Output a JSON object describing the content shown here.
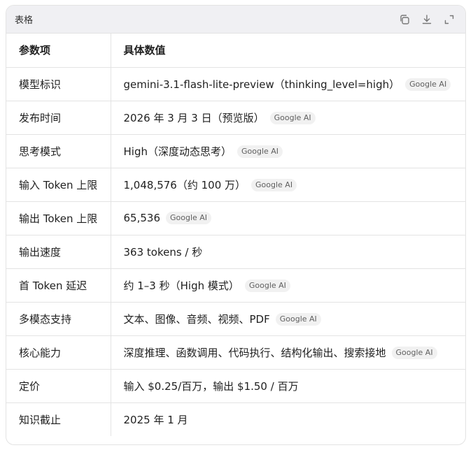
{
  "header": {
    "title": "表格"
  },
  "table": {
    "headers": [
      "参数项",
      "具体数值"
    ],
    "rows": [
      {
        "key": "模型标识",
        "value": "gemini-3.1-flash-lite-preview（thinking_level=high）",
        "source": "Google AI"
      },
      {
        "key": "发布时间",
        "value": "2026 年 3 月 3 日（预览版）",
        "source": "Google AI"
      },
      {
        "key": "思考模式",
        "value": "High（深度动态思考）",
        "source": "Google AI"
      },
      {
        "key": "输入 Token 上限",
        "value": "1,048,576（约 100 万）",
        "source": "Google AI"
      },
      {
        "key": "输出 Token 上限",
        "value": "65,536",
        "source": "Google AI"
      },
      {
        "key": "输出速度",
        "value": "363 tokens / 秒",
        "source": ""
      },
      {
        "key": "首 Token 延迟",
        "value": "约 1–3 秒（High 模式）",
        "source": "Google AI"
      },
      {
        "key": "多模态支持",
        "value": "文本、图像、音频、视频、PDF",
        "source": "Google AI"
      },
      {
        "key": "核心能力",
        "value": "深度推理、函数调用、代码执行、结构化输出、搜索接地",
        "source": "Google AI"
      },
      {
        "key": "定价",
        "value": "输入 $0.25/百万，输出 $1.50 / 百万",
        "source": ""
      },
      {
        "key": "知识截止",
        "value": "2025 年 1 月",
        "source": ""
      }
    ]
  },
  "icons": {
    "copy": "copy-icon",
    "download": "download-icon",
    "expand": "expand-icon"
  }
}
